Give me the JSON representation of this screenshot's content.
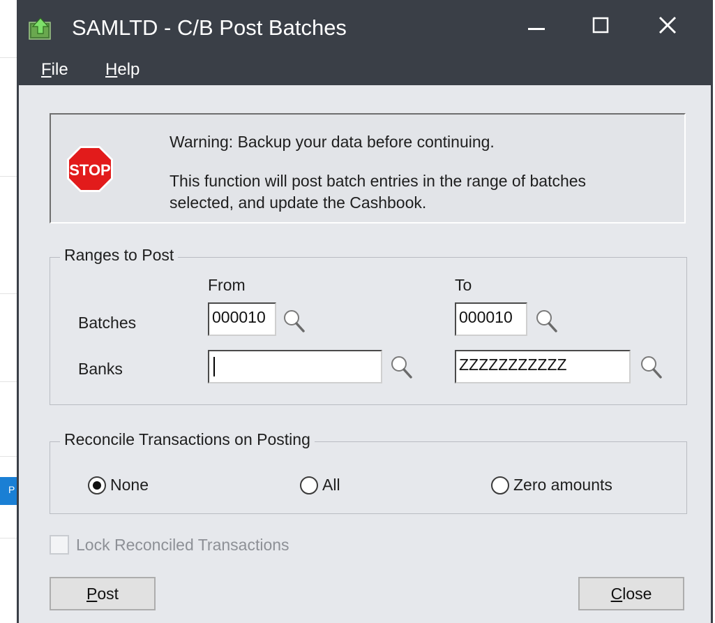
{
  "window": {
    "title": "SAMLTD - C/B Post Batches",
    "controls": {
      "minimize_icon": "minimize-icon",
      "maximize_icon": "maximize-icon",
      "close_icon": "close-icon"
    }
  },
  "menu": {
    "file": {
      "mnemonic": "F",
      "rest": "ile"
    },
    "help": {
      "mnemonic": "H",
      "rest": "elp"
    }
  },
  "warning": {
    "icon": "stop-sign-icon",
    "stop_text": "STOP",
    "line1": "Warning: Backup your data before continuing.",
    "line2": "This function will post batch entries in the range of batches",
    "line3": "selected, and update the Cashbook."
  },
  "ranges": {
    "legend": "Ranges to Post",
    "from_header": "From",
    "to_header": "To",
    "batches_label": "Batches",
    "banks_label": "Banks",
    "batches_from": "000010",
    "batches_to": "000010",
    "banks_from": "",
    "banks_to": "ZZZZZZZZZZZ"
  },
  "reconcile": {
    "legend": "Reconcile Transactions on Posting",
    "options": [
      {
        "label": "None",
        "selected": true
      },
      {
        "label": "All",
        "selected": false
      },
      {
        "label": "Zero amounts",
        "selected": false
      }
    ]
  },
  "lock": {
    "label": "Lock Reconciled Transactions",
    "checked": false,
    "enabled": false
  },
  "buttons": {
    "post": {
      "mnemonic": "P",
      "rest": "ost"
    },
    "close": {
      "mnemonic": "C",
      "rest": "lose"
    }
  },
  "background": {
    "tab_text": "P"
  },
  "colors": {
    "titlebar": "#3a3f47",
    "dialog_bg": "#e6e8ec",
    "stop_red": "#e21b1b"
  }
}
